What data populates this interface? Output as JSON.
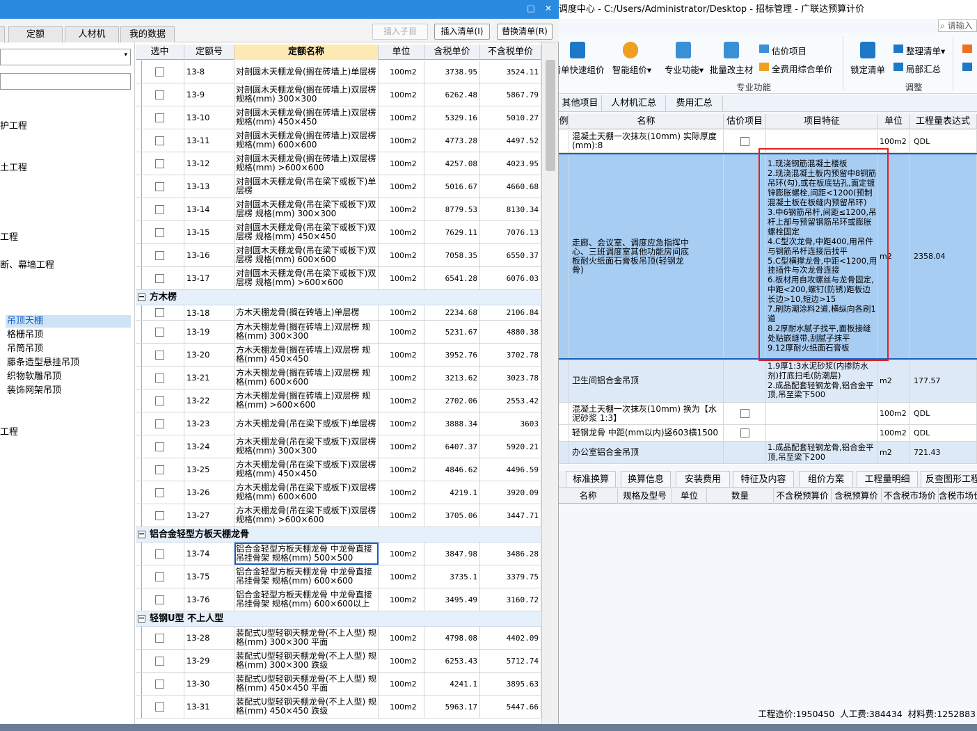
{
  "left_window": {
    "tabs": [
      "定额",
      "人材机",
      "我的数据"
    ],
    "actions": {
      "insert_child": "插入子目",
      "insert_list": "插入清单(I)",
      "replace_list": "替换清单(R)"
    },
    "tree": {
      "items": [
        "护工程",
        "土工程",
        "工程",
        "断、幕墙工程",
        "吊顶天棚",
        "格栅吊顶",
        "吊筒吊顶",
        "藤条造型悬挂吊顶",
        "织物软雕吊顶",
        "装饰网架吊顶",
        "工程"
      ],
      "selected": "吊顶天棚"
    },
    "grid": {
      "headers": [
        "选中",
        "定额号",
        "定额名称",
        "单位",
        "含税单价",
        "不含税单价"
      ],
      "rows_top": [
        {
          "code": "13-8",
          "name": "对剖圆木天棚龙骨(搁在砖墙上)单层楞",
          "unit": "100m2",
          "tax": "3738.95",
          "notax": "3524.11"
        },
        {
          "code": "13-9",
          "name": "对剖圆木天棚龙骨(搁在砖墙上)双层楞 规格(mm) 300×300",
          "unit": "100m2",
          "tax": "6262.48",
          "notax": "5867.79"
        },
        {
          "code": "13-10",
          "name": "对剖圆木天棚龙骨(搁在砖墙上)双层楞 规格(mm) 450×450",
          "unit": "100m2",
          "tax": "5329.16",
          "notax": "5010.27"
        },
        {
          "code": "13-11",
          "name": "对剖圆木天棚龙骨(搁在砖墙上)双层楞 规格(mm) 600×600",
          "unit": "100m2",
          "tax": "4773.28",
          "notax": "4497.52"
        },
        {
          "code": "13-12",
          "name": "对剖圆木天棚龙骨(搁在砖墙上)双层楞 规格(mm) >600×600",
          "unit": "100m2",
          "tax": "4257.08",
          "notax": "4023.95"
        },
        {
          "code": "13-13",
          "name": "对剖圆木天棚龙骨(吊在梁下或板下)单层楞",
          "unit": "100m2",
          "tax": "5016.67",
          "notax": "4660.68"
        },
        {
          "code": "13-14",
          "name": "对剖圆木天棚龙骨(吊在梁下或板下)双层楞 规格(mm) 300×300",
          "unit": "100m2",
          "tax": "8779.53",
          "notax": "8130.34"
        },
        {
          "code": "13-15",
          "name": "对剖圆木天棚龙骨(吊在梁下或板下)双层楞 规格(mm) 450×450",
          "unit": "100m2",
          "tax": "7629.11",
          "notax": "7076.13"
        },
        {
          "code": "13-16",
          "name": "对剖圆木天棚龙骨(吊在梁下或板下)双层楞 规格(mm) 600×600",
          "unit": "100m2",
          "tax": "7058.35",
          "notax": "6550.37"
        },
        {
          "code": "13-17",
          "name": "对剖圆木天棚龙骨(吊在梁下或板下)双层楞 规格(mm) >600×600",
          "unit": "100m2",
          "tax": "6541.28",
          "notax": "6076.03"
        }
      ],
      "group1": "方木楞",
      "rows_g1": [
        {
          "code": "13-18",
          "name": "方木天棚龙骨(搁在砖墙上)单层楞",
          "unit": "100m2",
          "tax": "2234.68",
          "notax": "2106.84"
        },
        {
          "code": "13-19",
          "name": "方木天棚龙骨(搁在砖墙上)双层楞 规格(mm) 300×300",
          "unit": "100m2",
          "tax": "5231.67",
          "notax": "4880.38"
        },
        {
          "code": "13-20",
          "name": "方木天棚龙骨(搁在砖墙上)双层楞 规格(mm) 450×450",
          "unit": "100m2",
          "tax": "3952.76",
          "notax": "3702.78"
        },
        {
          "code": "13-21",
          "name": "方木天棚龙骨(搁在砖墙上)双层楞 规格(mm) 600×600",
          "unit": "100m2",
          "tax": "3213.62",
          "notax": "3023.78"
        },
        {
          "code": "13-22",
          "name": "方木天棚龙骨(搁在砖墙上)双层楞 规格(mm) >600×600",
          "unit": "100m2",
          "tax": "2702.06",
          "notax": "2553.42"
        },
        {
          "code": "13-23",
          "name": "方木天棚龙骨(吊在梁下或板下)单层楞",
          "unit": "100m2",
          "tax": "3888.34",
          "notax": "3603"
        },
        {
          "code": "13-24",
          "name": "方木天棚龙骨(吊在梁下或板下)双层楞 规格(mm) 300×300",
          "unit": "100m2",
          "tax": "6407.37",
          "notax": "5920.21"
        },
        {
          "code": "13-25",
          "name": "方木天棚龙骨(吊在梁下或板下)双层楞 规格(mm) 450×450",
          "unit": "100m2",
          "tax": "4846.62",
          "notax": "4496.59"
        },
        {
          "code": "13-26",
          "name": "方木天棚龙骨(吊在梁下或板下)双层楞 规格(mm) 600×600",
          "unit": "100m2",
          "tax": "4219.1",
          "notax": "3920.09"
        },
        {
          "code": "13-27",
          "name": "方木天棚龙骨(吊在梁下或板下)双层楞 规格(mm) >600×600",
          "unit": "100m2",
          "tax": "3705.06",
          "notax": "3447.71"
        }
      ],
      "group2": "铝合金轻型方板天棚龙骨",
      "rows_g2": [
        {
          "code": "13-74",
          "name": "铝合金轻型方板天棚龙骨 中龙骨直接吊挂骨架 规格(mm) 500×500",
          "unit": "100m2",
          "tax": "3847.98",
          "notax": "3486.28"
        },
        {
          "code": "13-75",
          "name": "铝合金轻型方板天棚龙骨 中龙骨直接吊挂骨架 规格(mm) 600×600",
          "unit": "100m2",
          "tax": "3735.1",
          "notax": "3379.75"
        },
        {
          "code": "13-76",
          "name": "铝合金轻型方板天棚龙骨 中龙骨直接吊挂骨架 规格(mm) 600×600以上",
          "unit": "100m2",
          "tax": "3495.49",
          "notax": "3160.72"
        }
      ],
      "group3": "轻钢U型 不上人型",
      "rows_g3": [
        {
          "code": "13-28",
          "name": "装配式U型轻钢天棚龙骨(不上人型) 规格(mm) 300×300 平面",
          "unit": "100m2",
          "tax": "4798.08",
          "notax": "4402.09"
        },
        {
          "code": "13-29",
          "name": "装配式U型轻钢天棚龙骨(不上人型) 规格(mm) 300×300 跌级",
          "unit": "100m2",
          "tax": "6253.43",
          "notax": "5712.74"
        },
        {
          "code": "13-30",
          "name": "装配式U型轻钢天棚龙骨(不上人型) 规格(mm) 450×450 平面",
          "unit": "100m2",
          "tax": "4241.1",
          "notax": "3895.63"
        },
        {
          "code": "13-31",
          "name": "装配式U型轻钢天棚龙骨(不上人型) 规格(mm) 450×450 跌级",
          "unit": "100m2",
          "tax": "5963.17",
          "notax": "5447.66"
        }
      ]
    }
  },
  "right_window": {
    "title": "调度中心 - C:/Users/Administrator/Desktop - 招标管理 - 广联达预算计价",
    "search_placeholder": "请输入",
    "ribbon": {
      "buttons": [
        "清单快速组价",
        "智能组价",
        "专业功能",
        "批量改主材",
        "锁定清单"
      ],
      "small_buttons": [
        "估价项目",
        "全费用综合单价",
        "整理清单",
        "局部汇总"
      ],
      "groups": [
        "专业功能",
        "调整"
      ]
    },
    "tabs": [
      "其他项目",
      "人材机汇总",
      "费用汇总"
    ],
    "grid_headers": [
      "名称",
      "估价项目",
      "项目特征",
      "单位",
      "工程量表达式"
    ],
    "rows": [
      {
        "name": "混凝土天棚一次抹灰(10mm) 实际厚度(mm):8",
        "feature": "",
        "unit": "100m2",
        "qty": "QDL",
        "check": true
      },
      {
        "name": "走廊、会议室、调度应急指挥中心、三班调度室其他功能房间底板耐火纸面石膏板吊顶(轻钢龙骨)",
        "feature": "1.现浇钢筋混凝土楼板\n2.现浇混凝土板内预留中8铜筋吊环(勾),或在板底钻孔,面定镀锌膨胀螺栓,间距<1200(预制混凝土板在板缝内预留吊环)\n3.中6钢筋吊杆,间距≤1200,吊杆上部与预留钢筋吊环或膨胀螺栓固定\n4.C型次龙骨,中距400,用吊件与钢筋吊杆连接后找平\n5.C型横撑龙骨,中距<1200,用挂插件与次龙骨连接\n6.板材用自攻螺丝与龙骨固定,中距<200,螺钉(防锈)距板边长边>10,短边>15\n7.刷防潮涂料2道,横纵向各刷1道\n8.2厚耐水腻子找平,面板接缝处贴嵌缝带,刮腻子抹平\n9.12厚耐火纸面石膏板",
        "unit": "m2",
        "qty": "2358.04",
        "check": false
      },
      {
        "name": "卫生间铝合金吊顶",
        "feature": "1.9厚1:3水泥砂浆(内掺防水剂)打底扫毛(防潮层)\n2.成品配套轻钢龙骨,铝合金平顶,吊至梁下500",
        "unit": "m2",
        "qty": "177.57",
        "check": false
      },
      {
        "name": "混凝土天棚一次抹灰(10mm) 换为【水泥砂浆 1:3】",
        "feature": "",
        "unit": "100m2",
        "qty": "QDL",
        "check": true
      },
      {
        "name": "轻钢龙骨 中距(mm以内)竖603横1500",
        "feature": "",
        "unit": "100m2",
        "qty": "QDL",
        "check": true
      },
      {
        "name": "办公室铝合金吊顶",
        "feature": "1.成品配套轻钢龙骨,铝合金平顶,吊至梁下200",
        "unit": "m2",
        "qty": "721.43",
        "check": false
      }
    ],
    "bottom_tabs": [
      "标准换算",
      "换算信息",
      "安装费用",
      "特征及内容",
      "组价方案",
      "工程量明细",
      "反查图形工程量"
    ],
    "bottom_headers": [
      "名称",
      "规格及型号",
      "单位",
      "数量",
      "不含税预算价",
      "含税预算价",
      "不含税市场价",
      "含税市场价"
    ],
    "status": {
      "total": "工程造价:1950450",
      "labor": "人工费:384434",
      "material": "材料费:1252883"
    }
  }
}
